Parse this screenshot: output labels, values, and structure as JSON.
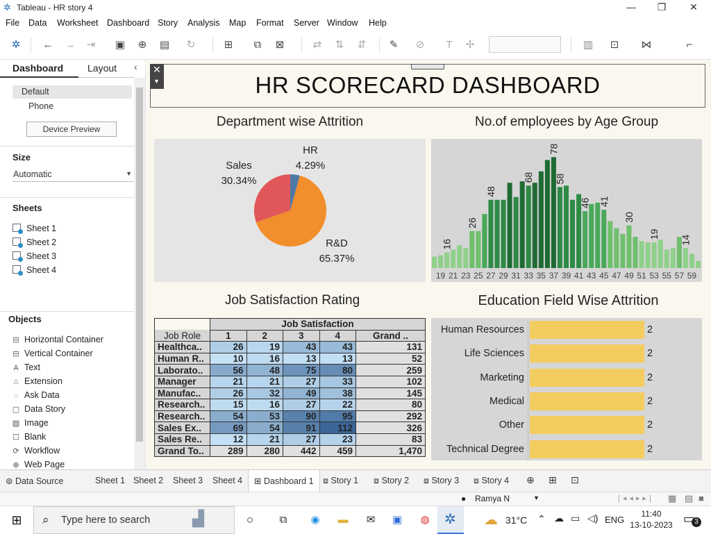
{
  "window": {
    "title": "Tableau - HR story 4",
    "controls": [
      "—",
      "❐",
      "✕"
    ]
  },
  "menu": [
    "File",
    "Data",
    "Worksheet",
    "Dashboard",
    "Story",
    "Analysis",
    "Map",
    "Format",
    "Server",
    "Window",
    "Help"
  ],
  "side_panel": {
    "tabs": [
      "Dashboard",
      "Layout"
    ],
    "device_options": [
      "Default",
      "Phone"
    ],
    "device_preview_button": "Device Preview",
    "size_header": "Size",
    "size_value": "Automatic",
    "sheets_header": "Sheets",
    "sheets": [
      "Sheet 1",
      "Sheet 2",
      "Sheet 3",
      "Sheet 4"
    ],
    "objects_header": "Objects",
    "objects": [
      {
        "label": "Horizontal Container",
        "icon": "horizontal-container-icon"
      },
      {
        "label": "Vertical Container",
        "icon": "vertical-container-icon"
      },
      {
        "label": "Text",
        "icon": "text-icon"
      },
      {
        "label": "Extension",
        "icon": "extension-icon"
      },
      {
        "label": "Ask Data",
        "icon": "ask-data-icon"
      },
      {
        "label": "Data Story",
        "icon": "data-story-icon"
      },
      {
        "label": "Image",
        "icon": "image-icon"
      },
      {
        "label": "Blank",
        "icon": "blank-icon"
      },
      {
        "label": "Workflow",
        "icon": "workflow-icon"
      },
      {
        "label": "Web Page",
        "icon": "web-page-icon"
      }
    ]
  },
  "dashboard": {
    "title": "HR SCORECARD DASHBOARD",
    "pie_title": "Department wise Attrition",
    "age_title": "No.of employees by Age Group",
    "job_title": "Job Satisfaction Rating",
    "edu_title": "Education Field Wise Attrition"
  },
  "chart_data": [
    {
      "type": "pie",
      "title": "Department wise Attrition",
      "slices": [
        {
          "label": "HR",
          "value": 4.29,
          "display": "4.29%",
          "color": "#4e79a7"
        },
        {
          "label": "R&D",
          "value": 65.37,
          "display": "65.37%",
          "color": "#f28e2b"
        },
        {
          "label": "Sales",
          "value": 30.34,
          "display": "30.34%",
          "color": "#e15759"
        }
      ]
    },
    {
      "type": "bar",
      "title": "No.of employees by Age Group",
      "categories": [
        18,
        19,
        20,
        21,
        22,
        23,
        24,
        25,
        26,
        27,
        28,
        29,
        30,
        31,
        32,
        33,
        34,
        35,
        36,
        37,
        38,
        39,
        40,
        41,
        42,
        43,
        44,
        45,
        46,
        47,
        48,
        49,
        50,
        51,
        52,
        53,
        54,
        55,
        56,
        57,
        58,
        59,
        60
      ],
      "values": [
        8,
        9,
        11,
        13,
        16,
        14,
        26,
        26,
        38,
        48,
        48,
        48,
        60,
        50,
        61,
        58,
        60,
        68,
        76,
        78,
        57,
        58,
        48,
        52,
        40,
        45,
        46,
        41,
        33,
        28,
        24,
        30,
        22,
        19,
        18,
        18,
        20,
        13,
        14,
        22,
        14,
        10,
        5
      ],
      "tick_labels": [
        "19",
        "21",
        "23",
        "25",
        "27",
        "29",
        "31",
        "33",
        "35",
        "37",
        "39",
        "41",
        "43",
        "45",
        "47",
        "49",
        "51",
        "53",
        "55",
        "57",
        "59"
      ],
      "data_labels": {
        "20": 16,
        "24": 26,
        "27": 48,
        "33": 68,
        "37": 78,
        "38": 58,
        "42": 46,
        "45": 41,
        "49": 30,
        "53": 19,
        "58": 14
      },
      "ylim": [
        0,
        80
      ]
    },
    {
      "type": "table",
      "title": "Job Satisfaction Rating",
      "column_group": "Job Satisfaction",
      "row_header": "Job Role",
      "columns": [
        "1",
        "2",
        "3",
        "4",
        "Grand .."
      ],
      "rows": [
        {
          "role": "Healthca..",
          "values": [
            26,
            19,
            43,
            43
          ],
          "total": "131"
        },
        {
          "role": "Human R..",
          "values": [
            10,
            16,
            13,
            13
          ],
          "total": "52"
        },
        {
          "role": "Laborato..",
          "values": [
            56,
            48,
            75,
            80
          ],
          "total": "259"
        },
        {
          "role": "Manager",
          "values": [
            21,
            21,
            27,
            33
          ],
          "total": "102"
        },
        {
          "role": "Manufac..",
          "values": [
            26,
            32,
            49,
            38
          ],
          "total": "145"
        },
        {
          "role": "Research..",
          "values": [
            15,
            16,
            27,
            22
          ],
          "total": "80"
        },
        {
          "role": "Research..",
          "values": [
            54,
            53,
            90,
            95
          ],
          "total": "292"
        },
        {
          "role": "Sales Ex..",
          "values": [
            69,
            54,
            91,
            112
          ],
          "total": "326"
        },
        {
          "role": "Sales Re..",
          "values": [
            12,
            21,
            27,
            23
          ],
          "total": "83"
        }
      ],
      "grand_total": {
        "role": "Grand To..",
        "values": [
          "289",
          "280",
          "442",
          "459"
        ],
        "total": "1,470"
      }
    },
    {
      "type": "bar",
      "title": "Education Field Wise Attrition",
      "categories": [
        "Human Resources",
        "Life Sciences",
        "Marketing",
        "Medical",
        "Other",
        "Technical Degree"
      ],
      "values": [
        2,
        2,
        2,
        2,
        2,
        2
      ],
      "color": "#f2cc5f"
    }
  ],
  "tabs": [
    "Data Source",
    "Sheet 1",
    "Sheet 2",
    "Sheet 3",
    "Sheet 4",
    "Dashboard 1",
    "Story 1",
    "Story 2",
    "Story 3",
    "Story 4"
  ],
  "active_tab": "Dashboard 1",
  "status": {
    "user": "Ramya N"
  },
  "taskbar": {
    "search_placeholder": "Type here to search",
    "temperature": "31°C",
    "language": "ENG",
    "time": "11:40",
    "date": "13-10-2023",
    "notifications": "3"
  }
}
